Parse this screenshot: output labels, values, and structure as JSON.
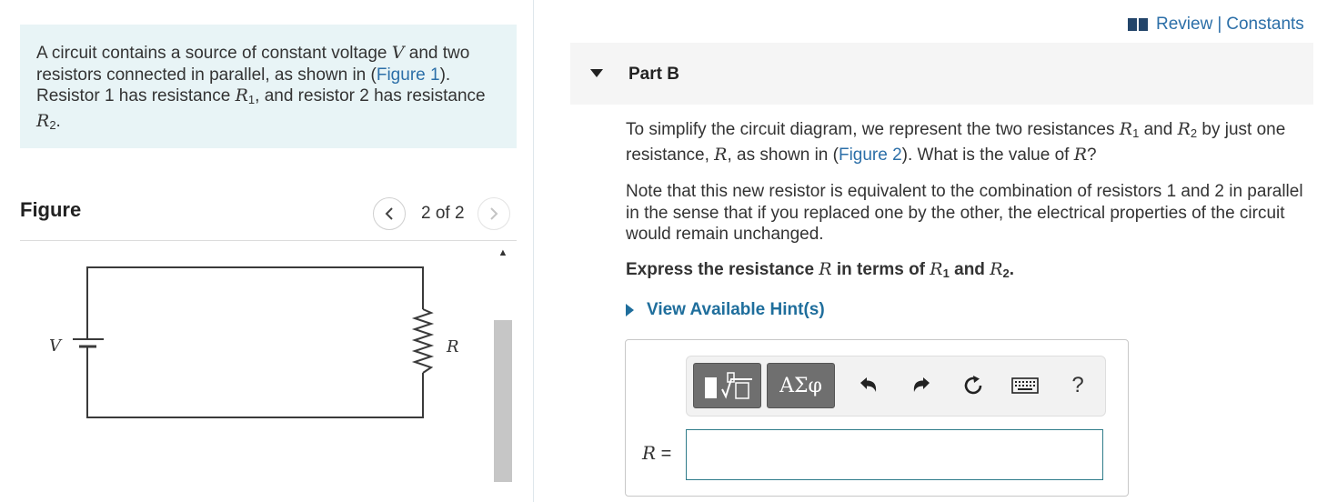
{
  "intro": {
    "pre": "A circuit contains a source of constant voltage ",
    "var_v": "V",
    "mid1": " and two resistors connected in parallel, as shown in (",
    "figure_link": "Figure 1",
    "mid2": "). Resistor 1 has resistance ",
    "var_r": "R",
    "sub1": "1",
    "mid3": ", and resistor 2 has resistance ",
    "sub2": "2",
    "end": "."
  },
  "figure": {
    "title": "Figure",
    "counter": "2 of 2",
    "prev_icon": "chevron-left-icon",
    "next_icon": "chevron-right-icon",
    "circuit": {
      "voltage_label": "V",
      "resistor_label": "R"
    }
  },
  "header": {
    "review_label": "Review",
    "separator": "|",
    "constants_label": "Constants",
    "book_icon": "book-icon"
  },
  "part": {
    "title": "Part B"
  },
  "question": {
    "p1_a": "To simplify the circuit diagram, we represent the two resistances ",
    "var_r": "R",
    "sub1": "1",
    "and": " and ",
    "sub2": "2",
    "p1_b": " by just one resistance, ",
    "p1_c": ", as shown in (",
    "figure_link": "Figure 2",
    "p1_d": "). What is the value of ",
    "q": "?",
    "p2": "Note that this new resistor is equivalent to the combination of resistors 1 and 2 in parallel in the sense that if you replaced one by the other, the electrical properties of the circuit would remain unchanged.",
    "express_a": "Express the resistance ",
    "express_b": " in terms of ",
    "express_end": "."
  },
  "hints": {
    "label": "View Available Hint(s)"
  },
  "answer": {
    "label_var": "R",
    "label_eq": " =",
    "value": "",
    "toolbar": {
      "greek_label": "ΑΣφ",
      "help_label": "?",
      "icons": [
        "templates-icon",
        "greek-letters-icon",
        "undo-icon",
        "redo-icon",
        "reset-icon",
        "keyboard-icon",
        "help-icon"
      ]
    }
  }
}
